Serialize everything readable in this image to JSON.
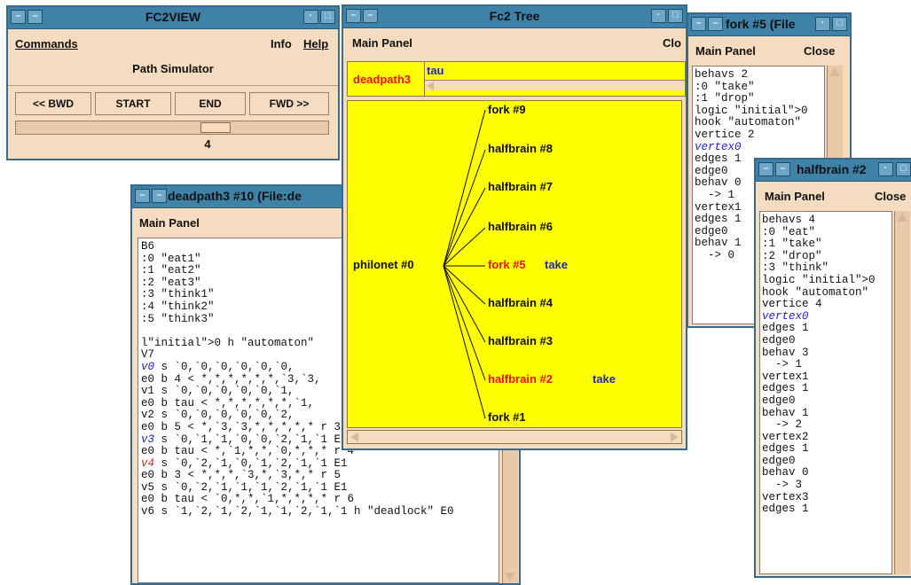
{
  "fc2view": {
    "title": "FC2VIEW",
    "menu_commands": "Commands",
    "menu_info": "Info",
    "menu_help": "Help",
    "heading": "Path Simulator",
    "buttons": [
      "<< BWD",
      "START",
      "END",
      "FWD >>"
    ],
    "step": "4"
  },
  "tree": {
    "title": "Fc2 Tree",
    "main_panel": "Main Panel",
    "close_label": "Clo",
    "path_label": "deadpath3",
    "path_value": "tau",
    "root": "philonet #0",
    "nodes": [
      "fork #9",
      "halfbrain #8",
      "halfbrain #7",
      "halfbrain #6",
      "fork #5",
      "halfbrain #4",
      "halfbrain #3",
      "halfbrain #2",
      "fork #1"
    ],
    "node5_action": "take",
    "node2_action": "take"
  },
  "deadpath": {
    "title": "deadpath3 #10 (File:de",
    "main_panel": "Main Panel",
    "lines": [
      {
        "t": "B6",
        "c": "#111111"
      },
      {
        "t": ":0 \"eat1\"",
        "c": "#111111"
      },
      {
        "t": ":1 \"eat2\"",
        "c": "#111111"
      },
      {
        "t": ":2 \"eat3\"",
        "c": "#111111"
      },
      {
        "t": ":3 \"think1\"",
        "c": "#111111"
      },
      {
        "t": ":4 \"think2\"",
        "c": "#111111"
      },
      {
        "t": ":5 \"think3\"",
        "c": "#111111"
      },
      {
        "t": "",
        "c": "#111111"
      },
      {
        "t": "l\"initial\">0 h \"automaton\"",
        "c": "#111111"
      },
      {
        "t": "V7",
        "c": "#111111"
      },
      {
        "t": "v0 s `0,`0,`0,`0,`0,`0,",
        "c": "#111111",
        "pre": "v0",
        "pc": "#2222cc"
      },
      {
        "t": "e0 b 4 < *,*,*,*,*,*,`3,`3,",
        "c": "#111111"
      },
      {
        "t": "v1 s `0,`0,`0,`0,`0,`1,",
        "c": "#111111"
      },
      {
        "t": "e0 b tau < *,*,*,*,*,*,`1,",
        "c": "#111111"
      },
      {
        "t": "v2 s `0,`0,`0,`0,`0,`2,",
        "c": "#111111"
      },
      {
        "t": "e0 b 5 < *,`3,`3,*,*,*,*,* r 3",
        "c": "#111111"
      },
      {
        "t": "v3 s `0,`1,`1,`0,`0,`2,`1,`1 E1",
        "c": "#111111",
        "pre": "v3",
        "pc": "#2222cc"
      },
      {
        "t": "e0 b tau < *,`1,*,*,`0,*,*,* r 4",
        "c": "#111111"
      },
      {
        "t": "v4 s `0,`2,`1,`0,`1,`2,`1,`1 E1",
        "c": "#111111",
        "pre": "v4",
        "pc": "#cc2222"
      },
      {
        "t": "e0 b 3 < *,*,*,`3,*,`3,*,* r 5",
        "c": "#111111"
      },
      {
        "t": "v5 s `0,`2,`1,`1,`1,`2,`1,`1 E1",
        "c": "#111111"
      },
      {
        "t": "e0 b tau < `0,*,*,`1,*,*,*,* r 6",
        "c": "#111111"
      },
      {
        "t": "v6 s `1,`2,`1,`2,`1,`1,`2,`1,`1 h \"deadlock\" E0",
        "c": "#111111"
      }
    ]
  },
  "fork5": {
    "title": "fork #5 (File",
    "main_panel": "Main Panel",
    "close_label": "Close",
    "lines": [
      "behavs 2",
      ":0 \"take\"",
      ":1 \"drop\"",
      "logic \"initial\">0",
      "hook \"automaton\"",
      "vertice 2",
      "vertex0",
      "edges 1",
      "edge0",
      "behav 0",
      "  -> 1",
      "vertex1",
      "edges 1",
      "edge0",
      "behav 1",
      "  -> 0"
    ]
  },
  "halfbrain2": {
    "title": "halfbrain #2",
    "main_panel": "Main Panel",
    "close_label": "Close",
    "lines": [
      "behavs 4",
      ":0 \"eat\"",
      ":1 \"take\"",
      ":2 \"drop\"",
      ":3 \"think\"",
      "logic \"initial\">0",
      "hook \"automaton\"",
      "vertice 4",
      "vertex0",
      "edges 1",
      "edge0",
      "behav 3",
      "  -> 1",
      "vertex1",
      "edges 1",
      "edge0",
      "behav 1",
      "  -> 2",
      "vertex2",
      "edges 1",
      "edge0",
      "behav 0",
      "  -> 3",
      "vertex3",
      "edges 1"
    ]
  },
  "colors": {
    "titlebar": "#3f82a8",
    "panel": "#f5dcc0",
    "tree_bg": "#ffff00",
    "red": "#ee1111",
    "blue": "#2222cc"
  }
}
